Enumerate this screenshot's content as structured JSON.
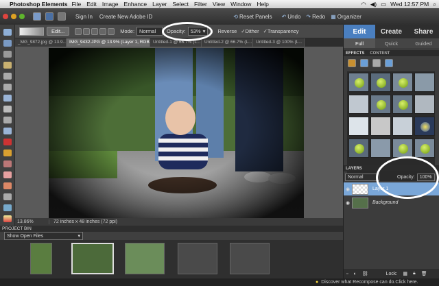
{
  "menubar": {
    "app_name": "Photoshop Elements",
    "items": [
      "File",
      "Edit",
      "Image",
      "Enhance",
      "Layer",
      "Select",
      "Filter",
      "View",
      "Window",
      "Help"
    ],
    "clock": "Wed 12:57 PM"
  },
  "appbar": {
    "sign_in": "Sign In",
    "create_id": "Create New Adobe ID",
    "reset_panels": "Reset Panels",
    "undo": "Undo",
    "redo": "Redo",
    "organizer": "Organizer"
  },
  "options": {
    "edit_label": "Edit...",
    "mode_label": "Mode:",
    "mode_value": "Normal",
    "opacity_label": "Opacity:",
    "opacity_value": "53%",
    "reverse_label": "Reverse",
    "dither_label": "Dither",
    "transparency_label": "Transparency"
  },
  "tabs": [
    "_MG_9872.jpg @ 13.9...",
    "IMG_9432.JPG @ 13.9% (Layer 1, RGB/8) *",
    "Untitled-1 @ 66.7% (L...",
    "Untitled-2 @ 66.7% (L...",
    "Untitled-3 @ 100% (L..."
  ],
  "status": {
    "zoom": "13.86%",
    "doc_size": "72 inches x 48 inches (72 ppi)"
  },
  "project_bin": {
    "title": "PROJECT BIN",
    "show_label": "Show Open Files"
  },
  "footer": {
    "tip": "Discover what Recompose can do.Click here."
  },
  "right_panel": {
    "tabs": [
      "Edit",
      "Create",
      "Share"
    ],
    "subtabs": [
      "Full",
      "Quick",
      "Guided"
    ],
    "effects_header": "EFFECTS",
    "content_header": "CONTENT",
    "layers_header": "LAYERS",
    "blend_mode": "Normal",
    "opacity_label": "Opacity:",
    "opacity_value": "100%",
    "layers": [
      "Layer 1",
      "Background"
    ],
    "lock_label": "Lock:"
  },
  "colors": {
    "accent": "#4a7fc0",
    "bg": "#3a3a3a"
  }
}
